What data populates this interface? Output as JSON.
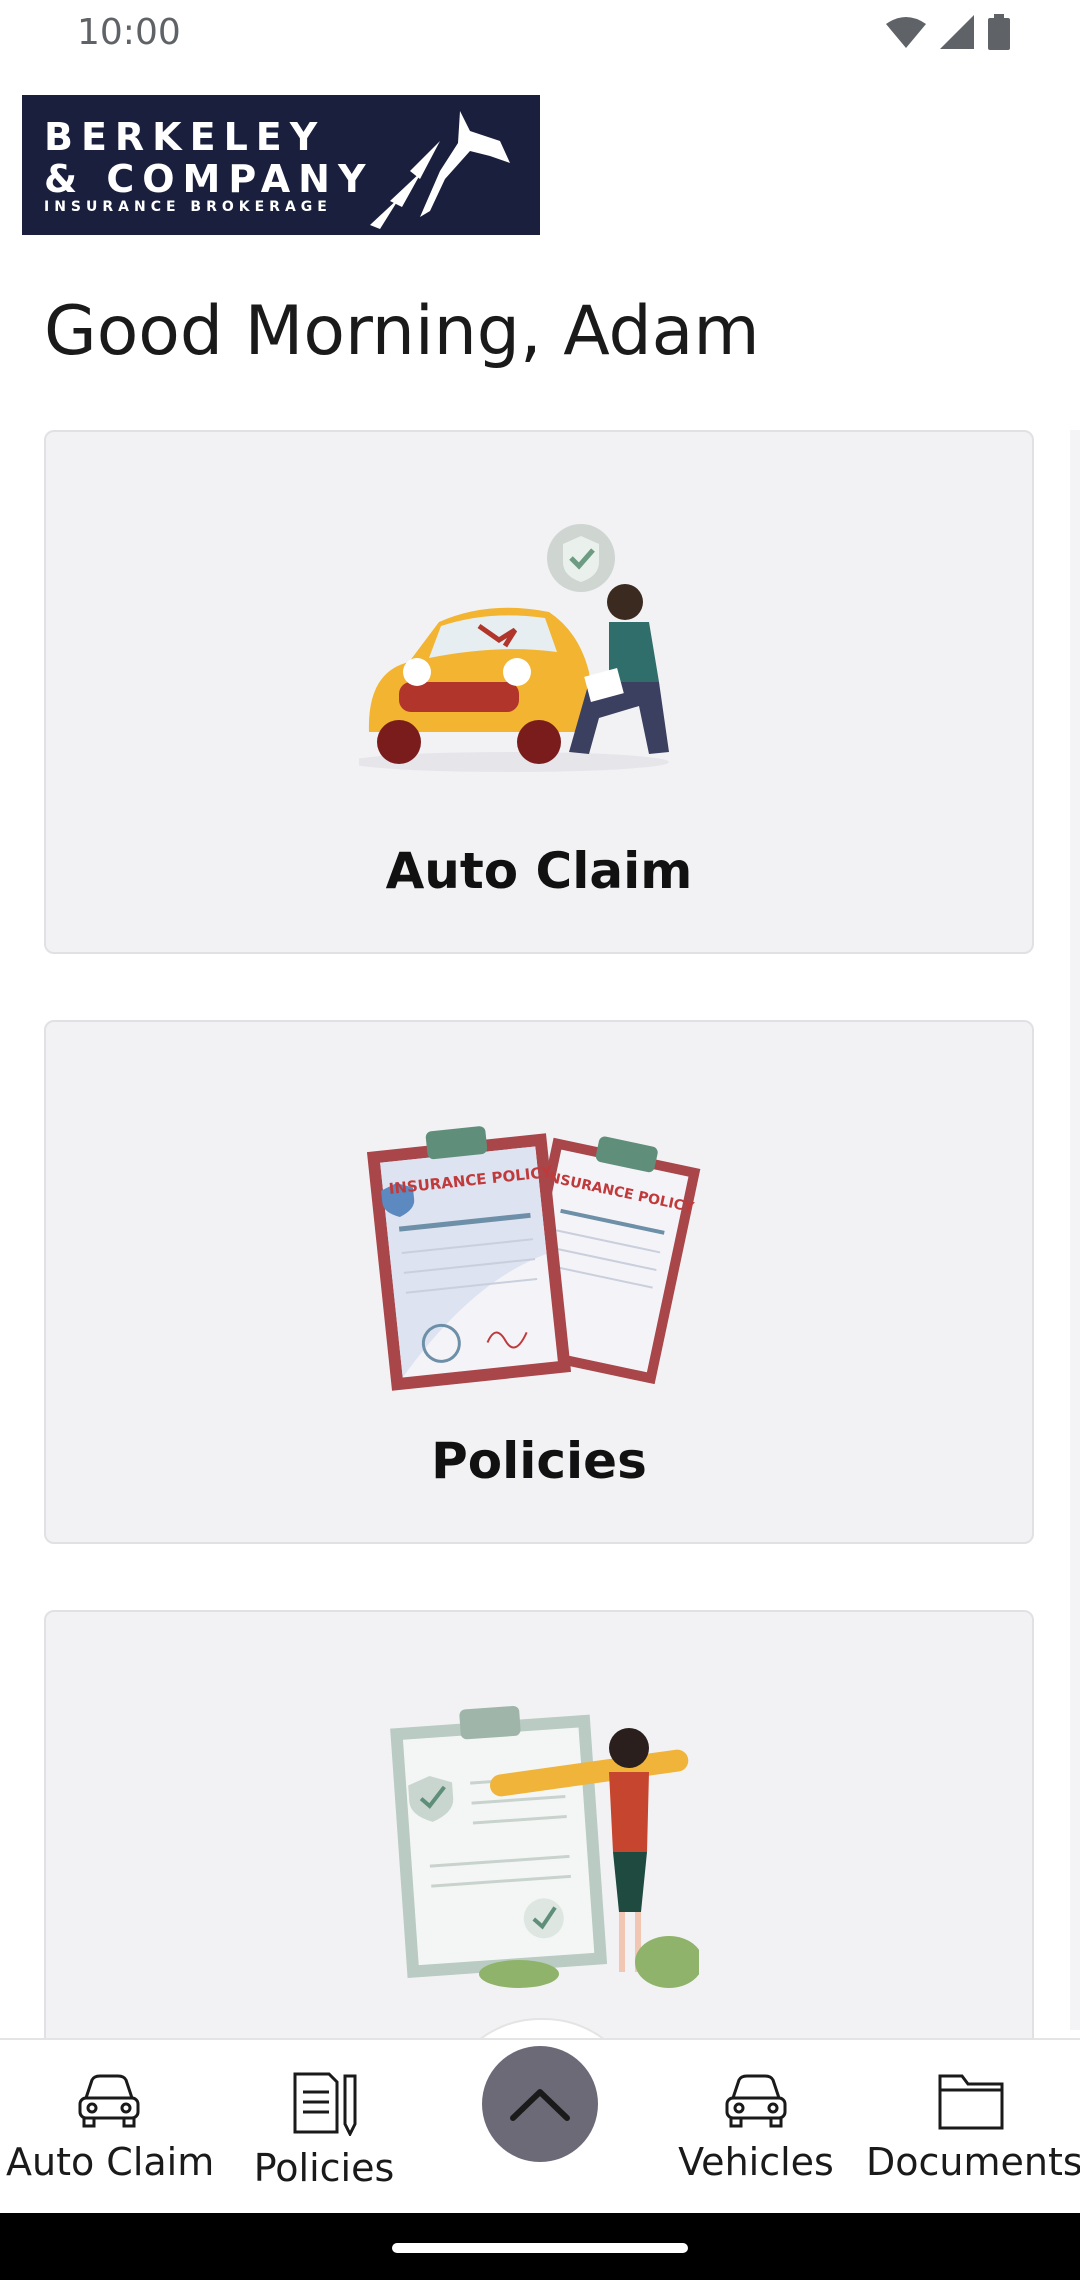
{
  "status": {
    "time": "10:00"
  },
  "logo": {
    "line1": "BERKELEY",
    "line2": "& COMPANY",
    "line3": "INSURANCE BROKERAGE"
  },
  "greeting": "Good Morning, Adam",
  "cards": [
    {
      "title": "Auto Claim",
      "illustration": "car-damage-illustration"
    },
    {
      "title": "Policies",
      "illustration": "insurance-policy-illustration",
      "doc_text": "INSURANCE POLICY"
    },
    {
      "title": "",
      "illustration": "checklist-illustration"
    }
  ],
  "nav": {
    "auto_claim": "Auto Claim",
    "policies": "Policies",
    "vehicles": "Vehicles",
    "documents": "Documents"
  },
  "colors": {
    "logo_bg": "#1a1f3d",
    "card_bg": "#f2f2f4",
    "fab": "#6d6a78"
  }
}
